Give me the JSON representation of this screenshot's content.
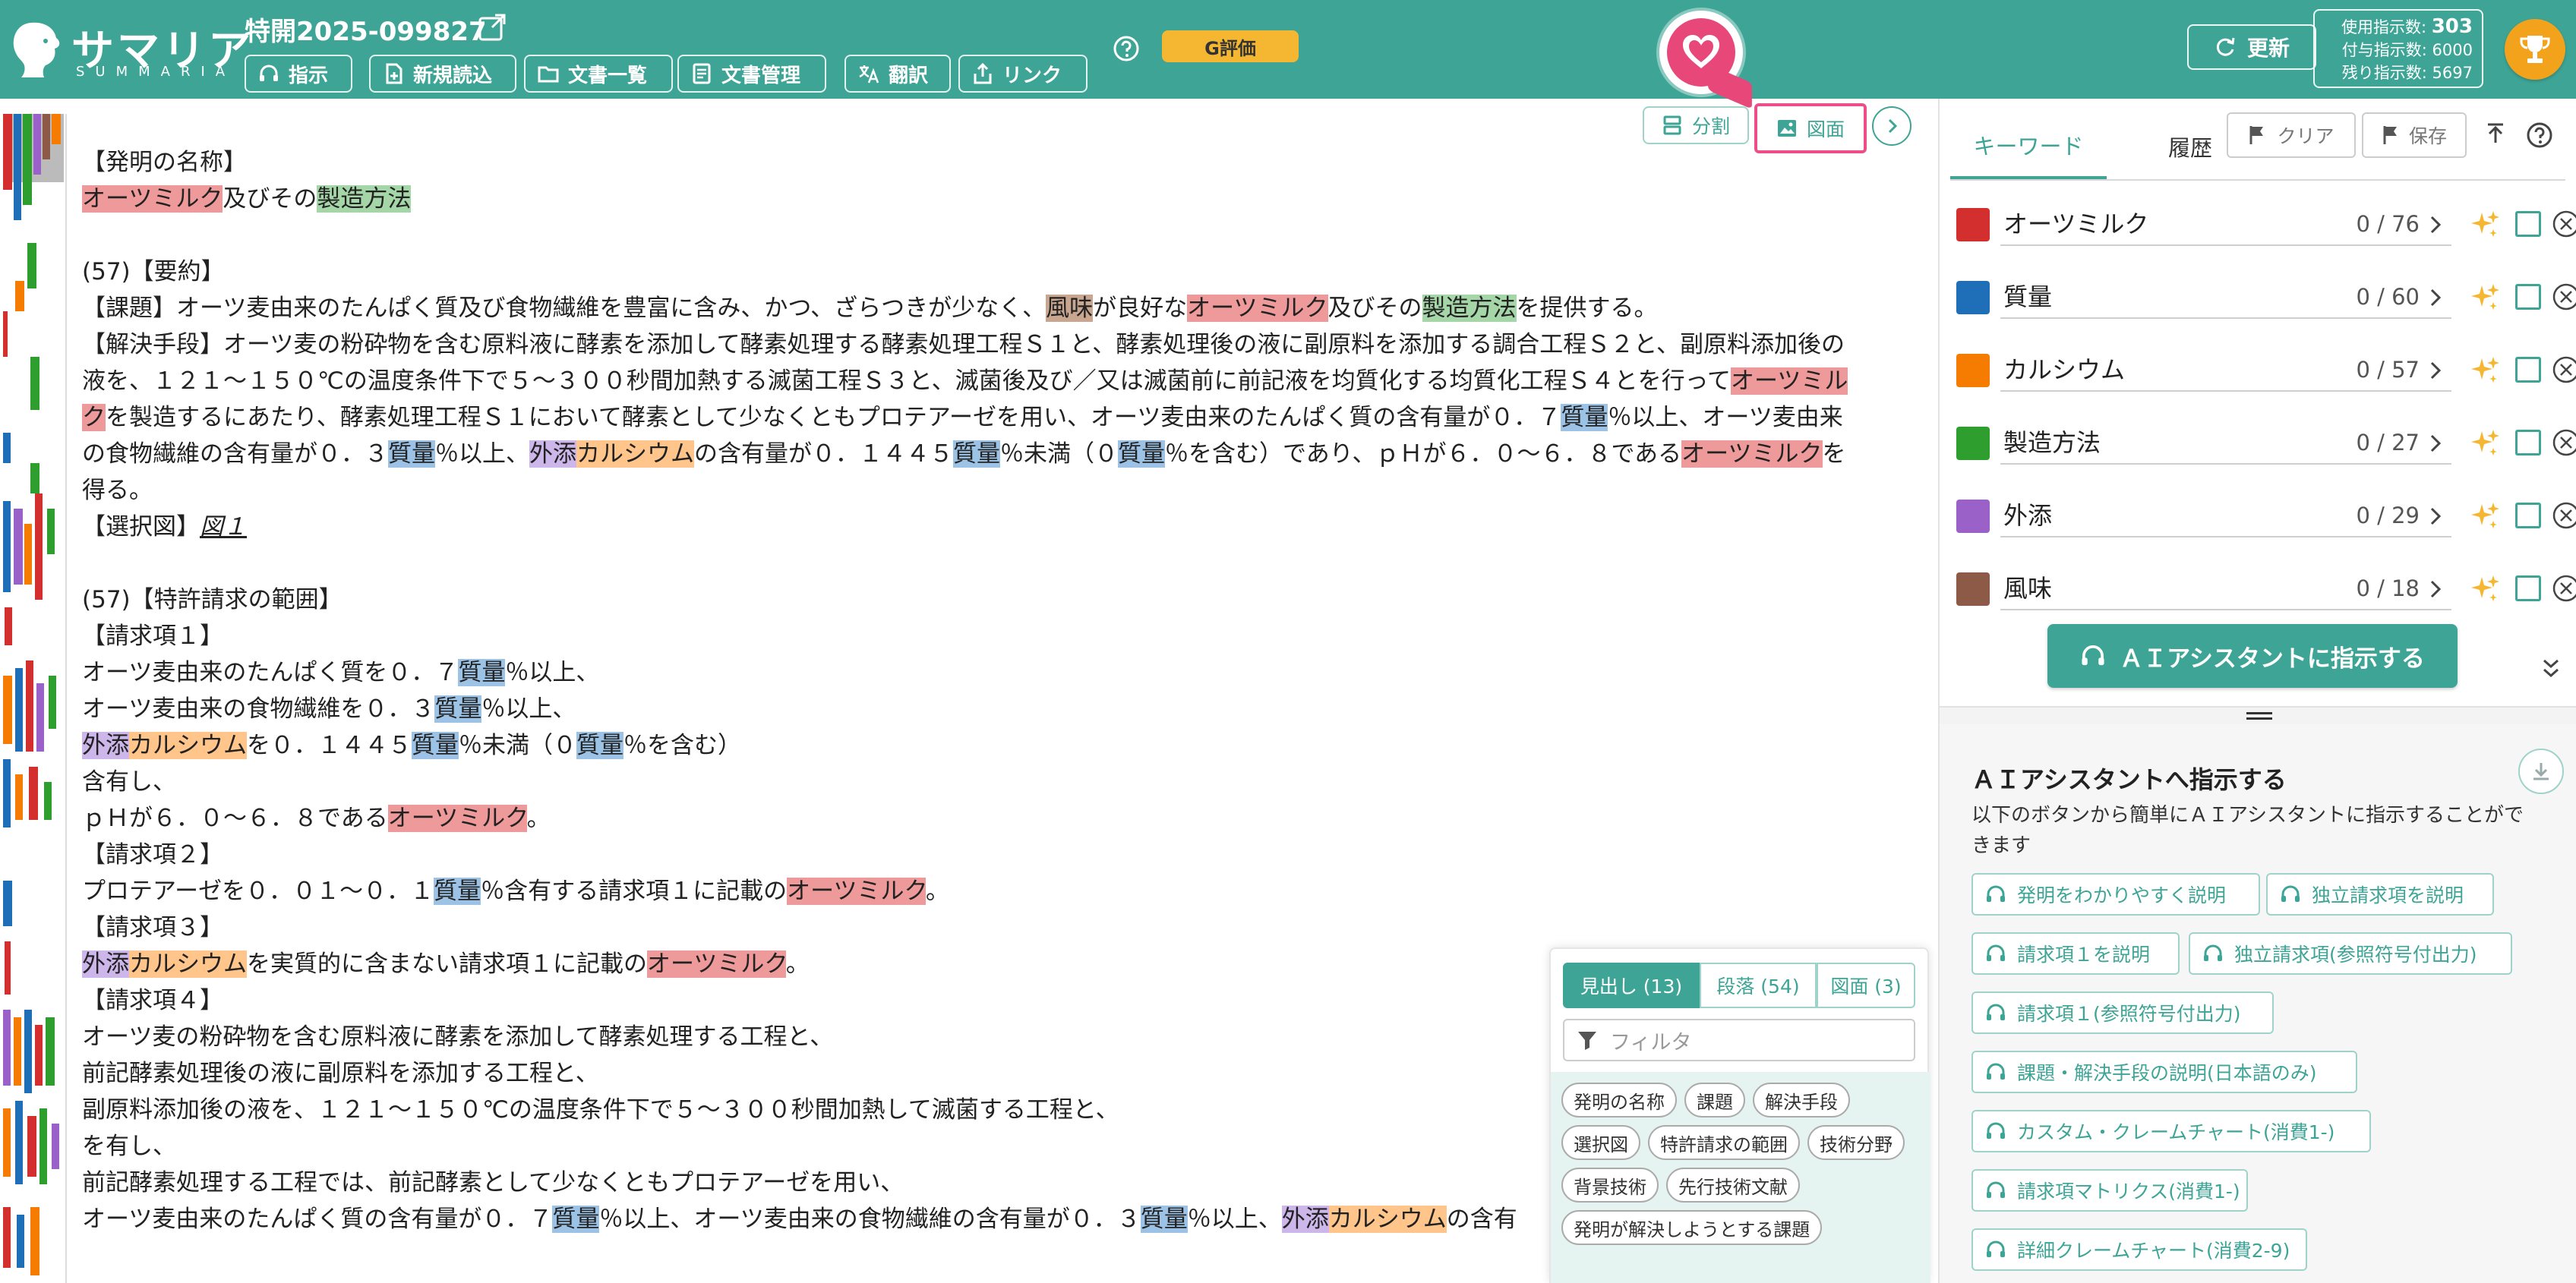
{
  "header": {
    "logo_text": "サマリア",
    "logo_sub": "SUMMARIA",
    "doc_number": "特開2025-099827",
    "buttons": {
      "instruct": "指示",
      "new_read": "新規読込",
      "doc_list": "文書一覧",
      "doc_manage": "文書管理",
      "translate": "翻訳",
      "link": "リンク"
    },
    "g_eval": "G評価",
    "update": "更新",
    "usage": {
      "used_label": "使用指示数:",
      "used_value": "303",
      "granted_label": "付与指示数:",
      "granted_value": "6000",
      "remaining_label": "残り指示数:",
      "remaining_value": "5697"
    }
  },
  "doc_toolbar": {
    "split": "分割",
    "figure": "図面"
  },
  "colors": {
    "brand": "#3ea596",
    "accent_pink": "#ec4f88",
    "g_eval": "#f5b731",
    "trophy": "#f2a31b"
  },
  "document": {
    "title_heading": "【発明の名称】",
    "title_kw1": "オーツミルク",
    "title_mid": "及びその",
    "title_kw2": "製造方法",
    "abstract_heading": "(57)【要約】",
    "problem_a": "【課題】オーツ麦由来のたんぱく質及び食物繊維を豊富に含み、かつ、ざらつきが少なく、",
    "problem_kw_flavor": "風味",
    "problem_b": "が良好な",
    "problem_kw_oat": "オーツミルク",
    "problem_c": "及びその",
    "problem_kw_method": "製造方法",
    "problem_d": "を提供する。",
    "sol_l1": "【解決手段】オーツ麦の粉砕物を含む原料液に酵素を添加して酵素処理する酵素処理工程Ｓ１と、酵素処理後の液に副原料を添加する調合工程Ｓ２と、副原料添加後の",
    "sol_l2a": "液を、１２１～１５０℃の温度条件下で５～３００秒間加熱する滅菌工程Ｓ３と、滅菌後及び／又は滅菌前に前記液を均質化する均質化工程Ｓ４とを行って",
    "sol_l2_kw": "オーツミル",
    "sol_l3_kw": "ク",
    "sol_l3a": "を製造するにあたり、酵素処理工程Ｓ１において酵素として少なくともプロテアーゼを用い、オーツ麦由来のたんぱく質の含有量が０．７",
    "sol_l3_q": "質量",
    "sol_l3b": "％以上、オーツ麦由来",
    "sol_l4a": "の食物繊維の含有量が０．３",
    "sol_l4_q1": "質量",
    "sol_l4b": "％以上、",
    "sol_l4_gaiten": "外添",
    "sol_l4_ca": "カルシウム",
    "sol_l4c": "の含有量が０．１４４５",
    "sol_l4_q2": "質量",
    "sol_l4d": "％未満（０",
    "sol_l4_q3": "質量",
    "sol_l4e": "％を含む）であり、ｐＨが６．０～６．８である",
    "sol_l4_oat": "オーツミルク",
    "sol_l4f": "を",
    "sol_l5": "得る。",
    "selected_fig_label": "【選択図】",
    "selected_fig_value": "図１",
    "claims_heading": "(57)【特許請求の範囲】",
    "claim1_heading": "【請求項１】",
    "c1_l1a": "オーツ麦由来のたんぱく質を０．７",
    "c1_l1q": "質量",
    "c1_l1b": "％以上、",
    "c1_l2a": "オーツ麦由来の食物繊維を０．３",
    "c1_l2q": "質量",
    "c1_l2b": "％以上、",
    "c1_l3_gaiten": "外添",
    "c1_l3_ca": "カルシウム",
    "c1_l3a": "を０．１４４５",
    "c1_l3q1": "質量",
    "c1_l3b": "％未満（０",
    "c1_l3q2": "質量",
    "c1_l3c": "％を含む）",
    "c1_l4": "含有し、",
    "c1_l5a": "ｐＨが６．０～６．８である",
    "c1_l5_oat": "オーツミルク",
    "c1_l5b": "。",
    "claim2_heading": "【請求項２】",
    "c2_a": "プロテアーゼを０．０１～０．１",
    "c2_q": "質量",
    "c2_b": "％含有する請求項１に記載の",
    "c2_oat": "オーツミルク",
    "c2_c": "。",
    "claim3_heading": "【請求項３】",
    "c3_gaiten": "外添",
    "c3_ca": "カルシウム",
    "c3_a": "を実質的に含まない請求項１に記載の",
    "c3_oat": "オーツミルク",
    "c3_b": "。",
    "claim4_heading": "【請求項４】",
    "c4_l1": "オーツ麦の粉砕物を含む原料液に酵素を添加して酵素処理する工程と、",
    "c4_l2": "前記酵素処理後の液に副原料を添加する工程と、",
    "c4_l3": "副原料添加後の液を、１２１～１５０℃の温度条件下で５～３００秒間加熱して滅菌する工程と、",
    "c4_l4": "を有し、",
    "c4_l5": "前記酵素処理する工程では、前記酵素として少なくともプロテアーゼを用い、",
    "c4_l6a": "オーツ麦由来のたんぱく質の含有量が０．７",
    "c4_l6q1": "質量",
    "c4_l6b": "％以上、オーツ麦由来の食物繊維の含有量が０．３",
    "c4_l6q2": "質量",
    "c4_l6c": "％以上、",
    "c4_l6_gaiten": "外添",
    "c4_l6_ca": "カルシウム",
    "c4_l6d": "の含有"
  },
  "outline": {
    "tabs": [
      "見出し (13)",
      "段落 (54)",
      "図面 (3)"
    ],
    "filter_placeholder": "フィルタ",
    "chips": [
      "発明の名称",
      "課題",
      "解決手段",
      "選択図",
      "特許請求の範囲",
      "技術分野",
      "背景技術",
      "先行技術文献",
      "発明が解決しようとする課題"
    ]
  },
  "keywords": {
    "tab_keyword": "キーワード",
    "tab_history": "履歴",
    "clear": "クリア",
    "save": "保存",
    "items": [
      {
        "label": "オーツミルク",
        "count": "0 / 76",
        "color": "#d32f2f"
      },
      {
        "label": "質量",
        "count": "0 / 60",
        "color": "#1e6eb8"
      },
      {
        "label": "カルシウム",
        "count": "0 / 57",
        "color": "#f57c00"
      },
      {
        "label": "製造方法",
        "count": "0 / 27",
        "color": "#2e9e2e"
      },
      {
        "label": "外添",
        "count": "0 / 29",
        "color": "#9a62c8"
      },
      {
        "label": "風味",
        "count": "0 / 18",
        "color": "#8d5a48"
      }
    ],
    "ai_instruct_button": "ＡＩアシスタントに指示する"
  },
  "ai_assistant": {
    "title": "ＡＩアシスタントへ指示する",
    "description": "以下のボタンから簡単にＡＩアシスタントに指示することができます",
    "buttons": [
      "発明をわかりやすく説明",
      "独立請求項を説明",
      "請求項１を説明",
      "独立請求項(参照符号付出力)",
      "請求項１(参照符号付出力)",
      "課題・解決手段の説明(日本語のみ)",
      "カスタム・クレームチャート(消費1-)",
      "請求項マトリクス(消費1-)",
      "詳細クレームチャート(消費2-9)"
    ]
  }
}
